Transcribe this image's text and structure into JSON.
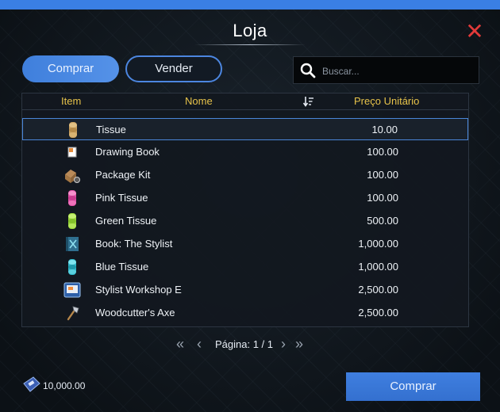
{
  "window": {
    "title": "Loja"
  },
  "tabs": {
    "buy_label": "Comprar",
    "sell_label": "Vender"
  },
  "search": {
    "placeholder": "Buscar..."
  },
  "table": {
    "headers": {
      "item": "Item",
      "name": "Nome",
      "price": "Preço Unitário"
    },
    "rows": [
      {
        "icon": "tissue-roll-icon",
        "name": "Tissue",
        "price": "10.00",
        "selected": true
      },
      {
        "icon": "drawing-book-icon",
        "name": "Drawing Book",
        "price": "100.00"
      },
      {
        "icon": "package-kit-icon",
        "name": "Package Kit",
        "price": "100.00"
      },
      {
        "icon": "pink-tissue-icon",
        "name": "Pink Tissue",
        "price": "100.00"
      },
      {
        "icon": "green-tissue-icon",
        "name": "Green Tissue",
        "price": "500.00"
      },
      {
        "icon": "stylist-book-icon",
        "name": "Book: The Stylist",
        "price": "1,000.00"
      },
      {
        "icon": "blue-tissue-icon",
        "name": "Blue Tissue",
        "price": "1,000.00"
      },
      {
        "icon": "stylist-workshop-icon",
        "name": "Stylist Workshop E",
        "price": "2,500.00"
      },
      {
        "icon": "axe-icon",
        "name": "Woodcutter's Axe",
        "price": "2,500.00"
      }
    ]
  },
  "pagination": {
    "label": "Página: 1 / 1"
  },
  "footer": {
    "balance": "10,000.00",
    "buy_button": "Comprar"
  },
  "colors": {
    "accent": "#3f7fdc",
    "header_text": "#e6c24a",
    "close": "#e23a3a"
  }
}
